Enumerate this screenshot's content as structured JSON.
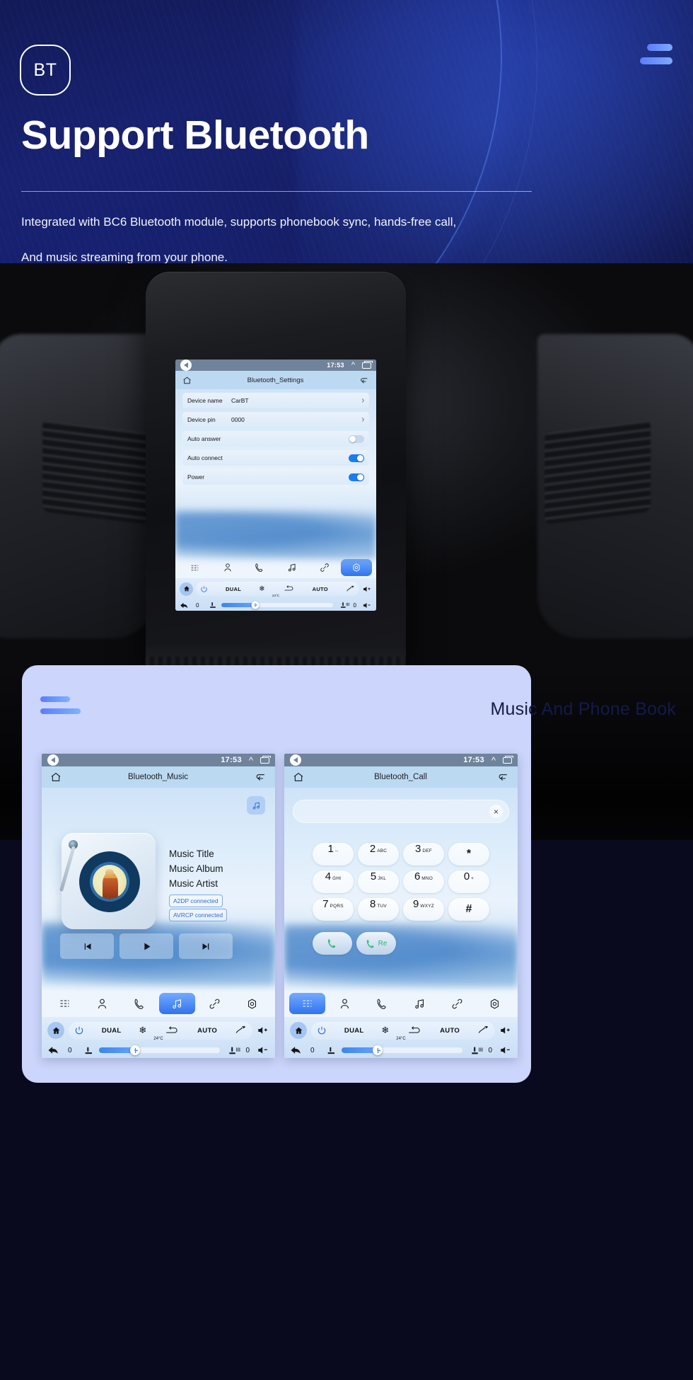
{
  "header": {
    "badge": "BT",
    "title": "Support Bluetooth",
    "subtitle_line1": "Integrated with BC6 Bluetooth module, supports phonebook sync, hands-free call,",
    "subtitle_line2": "And music streaming from your phone.",
    "menu_icon": "hamburger-icon",
    "accent": "#5b7dfb",
    "background": "#141a55"
  },
  "main_screen": {
    "status": {
      "clock": "17:53",
      "back_icon": "back-circle-icon",
      "expand_icon": "chevron-up-icon",
      "recent_icon": "recent-apps-icon"
    },
    "titlebar": {
      "home_icon": "home-icon",
      "title": "Bluetooth_Settings",
      "back_icon": "return-arrow-icon"
    },
    "settings_rows": [
      {
        "label": "Device name",
        "value": "CarBT",
        "control": "chevron",
        "chevron": "›"
      },
      {
        "label": "Device pin",
        "value": "0000",
        "control": "chevron",
        "chevron": "›"
      },
      {
        "label": "Auto answer",
        "value": "",
        "control": "toggle",
        "on": false
      },
      {
        "label": "Auto connect",
        "value": "",
        "control": "toggle",
        "on": true
      },
      {
        "label": "Power",
        "value": "",
        "control": "toggle",
        "on": true
      }
    ],
    "tabs": [
      {
        "name": "apps-grid-icon",
        "active": false
      },
      {
        "name": "contact-person-icon",
        "active": false
      },
      {
        "name": "phone-icon",
        "active": false
      },
      {
        "name": "music-note-icon",
        "active": false
      },
      {
        "name": "link-icon",
        "active": false
      },
      {
        "name": "settings-gear-icon",
        "active": true
      }
    ],
    "climate": {
      "home_icon": "home-icon",
      "power_icon": "power-icon",
      "dual_label": "DUAL",
      "snow_icon": "snowflake-icon",
      "recirc_icon": "air-recirculation-icon",
      "auto_label": "AUTO",
      "defrost_icon": "defrost-icon",
      "vol_up_icon": "volume-up-icon",
      "vol_down_icon": "volume-down-icon",
      "back_icon": "back-arrow-icon",
      "temp": "24°C",
      "left_value": "0",
      "right_value": "0",
      "seat_left_icon": "seat-icon",
      "seat_right_icon": "seat-heated-icon",
      "fan_icon": "fan-icon",
      "fan_percent": 30
    }
  },
  "card": {
    "title": "Music And Phone Book",
    "menu_icon": "hamburger-icon",
    "background": "#ccd5fb"
  },
  "music_screen": {
    "status": {
      "clock": "17:53"
    },
    "titlebar": {
      "title": "Bluetooth_Music"
    },
    "note_button_icon": "music-note-icon",
    "meta": {
      "title": "Music Title",
      "album": "Music Album",
      "artist": "Music Artist"
    },
    "badges": [
      "A2DP  connected",
      "AVRCP connected"
    ],
    "controls": [
      {
        "name": "previous-track-button",
        "icon": "skip-back-icon"
      },
      {
        "name": "play-button",
        "icon": "play-icon"
      },
      {
        "name": "next-track-button",
        "icon": "skip-forward-icon"
      }
    ],
    "tabs": [
      {
        "name": "apps-grid-icon",
        "active": false
      },
      {
        "name": "contact-person-icon",
        "active": false
      },
      {
        "name": "phone-icon",
        "active": false
      },
      {
        "name": "music-note-icon",
        "active": true
      },
      {
        "name": "link-icon",
        "active": false
      },
      {
        "name": "settings-gear-icon",
        "active": false
      }
    ],
    "climate": {
      "dual_label": "DUAL",
      "auto_label": "AUTO",
      "temp": "24°C",
      "left_value": "0",
      "right_value": "0",
      "fan_percent": 30
    }
  },
  "call_screen": {
    "status": {
      "clock": "17:53"
    },
    "titlebar": {
      "title": "Bluetooth_Call"
    },
    "search": {
      "value": "",
      "placeholder": "",
      "clear_icon": "×"
    },
    "keys": [
      {
        "digit": "1",
        "sub": "--"
      },
      {
        "digit": "2",
        "sub": "ABC"
      },
      {
        "digit": "3",
        "sub": "DEF"
      },
      {
        "digit": "*",
        "sub": ""
      },
      {
        "digit": "4",
        "sub": "GHI"
      },
      {
        "digit": "5",
        "sub": "JKL"
      },
      {
        "digit": "6",
        "sub": "MNO"
      },
      {
        "digit": "0",
        "sub": "+"
      },
      {
        "digit": "7",
        "sub": "PQRS"
      },
      {
        "digit": "8",
        "sub": "TUV"
      },
      {
        "digit": "9",
        "sub": "WXYZ"
      },
      {
        "digit": "#",
        "sub": ""
      }
    ],
    "call_button": {
      "name": "call-button",
      "icon": "phone-icon"
    },
    "redial_button": {
      "name": "redial-button",
      "icon": "phone-icon",
      "label": "Re"
    },
    "tabs": [
      {
        "name": "apps-grid-icon",
        "active": true
      },
      {
        "name": "contact-person-icon",
        "active": false
      },
      {
        "name": "phone-icon",
        "active": false
      },
      {
        "name": "music-note-icon",
        "active": false
      },
      {
        "name": "link-icon",
        "active": false
      },
      {
        "name": "settings-gear-icon",
        "active": false
      }
    ],
    "climate": {
      "dual_label": "DUAL",
      "auto_label": "AUTO",
      "temp": "24°C",
      "left_value": "0",
      "right_value": "0",
      "fan_percent": 30
    }
  }
}
